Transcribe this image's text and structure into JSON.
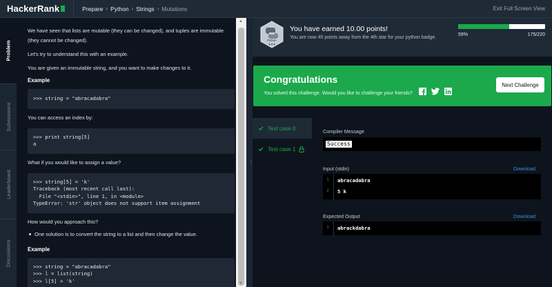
{
  "topbar": {
    "logo": "HackerRank",
    "breadcrumbs": [
      "Prepare",
      "Python",
      "Strings"
    ],
    "current": "Mutations",
    "exit_label": "Exit Full Screen View"
  },
  "vtabs": [
    "Problem",
    "Submissions",
    "Leaderboard",
    "Discussions"
  ],
  "problem": {
    "intro": "We have seen that lists are mutable (they can be changed), and tuples are immutable (they cannot be changed).",
    "lets": "Let's try to understand this with an example.",
    "given": "You are given an immutable string, and you want to make changes to it.",
    "example_heading": "Example",
    "code1": ">>> string = \"abracadabra\"",
    "access": "You can access an index by:",
    "code2": ">>> print string[5]\na",
    "assign": "What if you would like to assign a value?",
    "code3": ">>> string[5] = 'k'\nTraceback (most recent call last):\n  File \"<stdin>\", line 1, in <module>\nTypeError: 'str' object does not support item assignment",
    "approach": "How would you approach this?",
    "bullet": "One solution is to convert the string to a list and then change the value.",
    "example_heading2": "Example",
    "code4": ">>> string = \"abracadabra\"\n>>> l = list(string)\n>>> l[5] = 'k'"
  },
  "banner": {
    "earned": "You have earned 10.00 points!",
    "sub": "You are now 45 points away from the 4th star for your python badge.",
    "badge_label": "Python",
    "progress_fraction": 0.59,
    "progress_pct": "59%",
    "points": "175/220"
  },
  "congrats": {
    "title": "Congratulations",
    "sub": "You solved this challenge. Would you like to challenge your friends?",
    "next": "Next Challenge"
  },
  "tests": [
    {
      "label": "Test case 0"
    },
    {
      "label": "Test case 1"
    }
  ],
  "output": {
    "compiler_label": "Compiler Message",
    "compiler_value": "Success",
    "input_label": "Input (stdin)",
    "download": "Download",
    "input_lines": [
      "abracadabra",
      "5 k"
    ],
    "expected_label": "Expected Output",
    "expected_lines": [
      "abrackdabra"
    ]
  },
  "colors": {
    "accent": "#1ba94c",
    "link": "#3f8ce6",
    "bg": "#0e141e"
  }
}
